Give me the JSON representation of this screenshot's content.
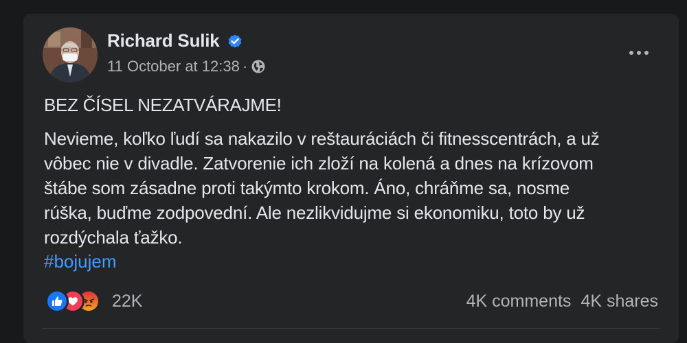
{
  "post": {
    "author": "Richard Sulik",
    "verified": true,
    "timestamp": "11 October at 12:38",
    "meta_separator": "·",
    "audience_icon": "globe-icon",
    "headline": "BEZ ČÍSEL NEZATVÁRAJME!",
    "body": "Nevieme, koľko ľudí sa nakazilo v reštauráciách či fitnesscentrách, a už\nvôbec nie v divadle. Zatvorenie ich zloží na kolená a dnes na krízovom\nštábe som zásadne proti takýmto krokom. Áno, chráňme sa, nosme\nrúška, buďme zodpovední. Ale nezlikvidujme si ekonomiku, toto by už\nrozdýchala ťažko.",
    "hashtag": "#bojujem"
  },
  "engagement": {
    "reactions": [
      "like",
      "love",
      "angry"
    ],
    "reaction_count": "22K",
    "comments": "4K comments",
    "shares": "4K shares"
  },
  "colors": {
    "background": "#18191a",
    "card": "#242526",
    "text_primary": "#e4e6eb",
    "text_secondary": "#b0b3b8",
    "link": "#4599ff",
    "verified": "#2d88ff",
    "like": "#1877f2",
    "love": "#f33e58",
    "angry": "#e9710f"
  }
}
